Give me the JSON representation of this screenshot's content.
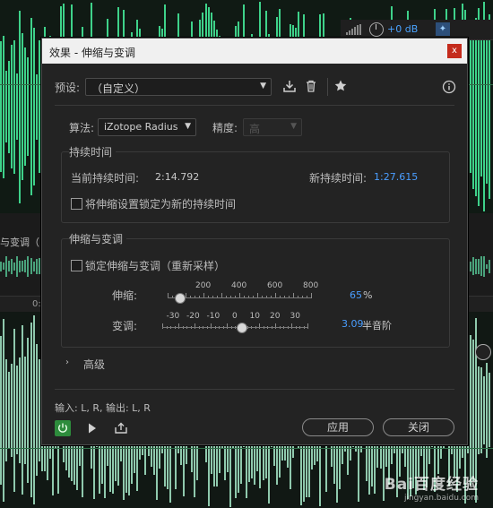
{
  "dialog": {
    "title": "效果 - 伸缩与变调",
    "close_label": "x",
    "preset": {
      "label": "预设:",
      "value": "（自定义）"
    },
    "algorithm": {
      "label": "算法:",
      "value": "iZotope Radius"
    },
    "precision": {
      "label": "精度:",
      "value": "高"
    },
    "duration_group": {
      "title": "持续时间",
      "current_label": "当前持续时间:",
      "current_value": "2:14.792",
      "new_label": "新持续时间:",
      "new_value": "1:27.615",
      "lock_label": "将伸缩设置锁定为新的持续时间"
    },
    "stretch_group": {
      "title": "伸缩与变调",
      "lock_label": "锁定伸缩与变调（重新采样）",
      "stretch": {
        "label": "伸缩:",
        "tick_labels": [
          "200",
          "400",
          "600",
          "800"
        ],
        "value": "65",
        "unit": "%",
        "level": 65
      },
      "pitch": {
        "label": "变调:",
        "tick_labels": [
          "-30",
          "-20",
          "-10",
          "0",
          "10",
          "20",
          "30"
        ],
        "value": "3.09",
        "unit": "半音阶",
        "level": 3.09
      }
    },
    "advanced_label": "高级",
    "io_text": "输入: L, R,  输出: L, R",
    "apply_label": "应用",
    "close_button_label": "关闭"
  },
  "background": {
    "level_db": "+0 dB",
    "mid_label": "与变调（",
    "ruler_label": "0:"
  },
  "watermark": {
    "brand": "Bai百度经验",
    "url": "jingyan.baidu.com"
  },
  "colors": {
    "accent_blue": "#4a9eff",
    "waveform_green": "#3ed28a",
    "power_green": "#2d8c3c",
    "close_red": "#c42b1c"
  }
}
